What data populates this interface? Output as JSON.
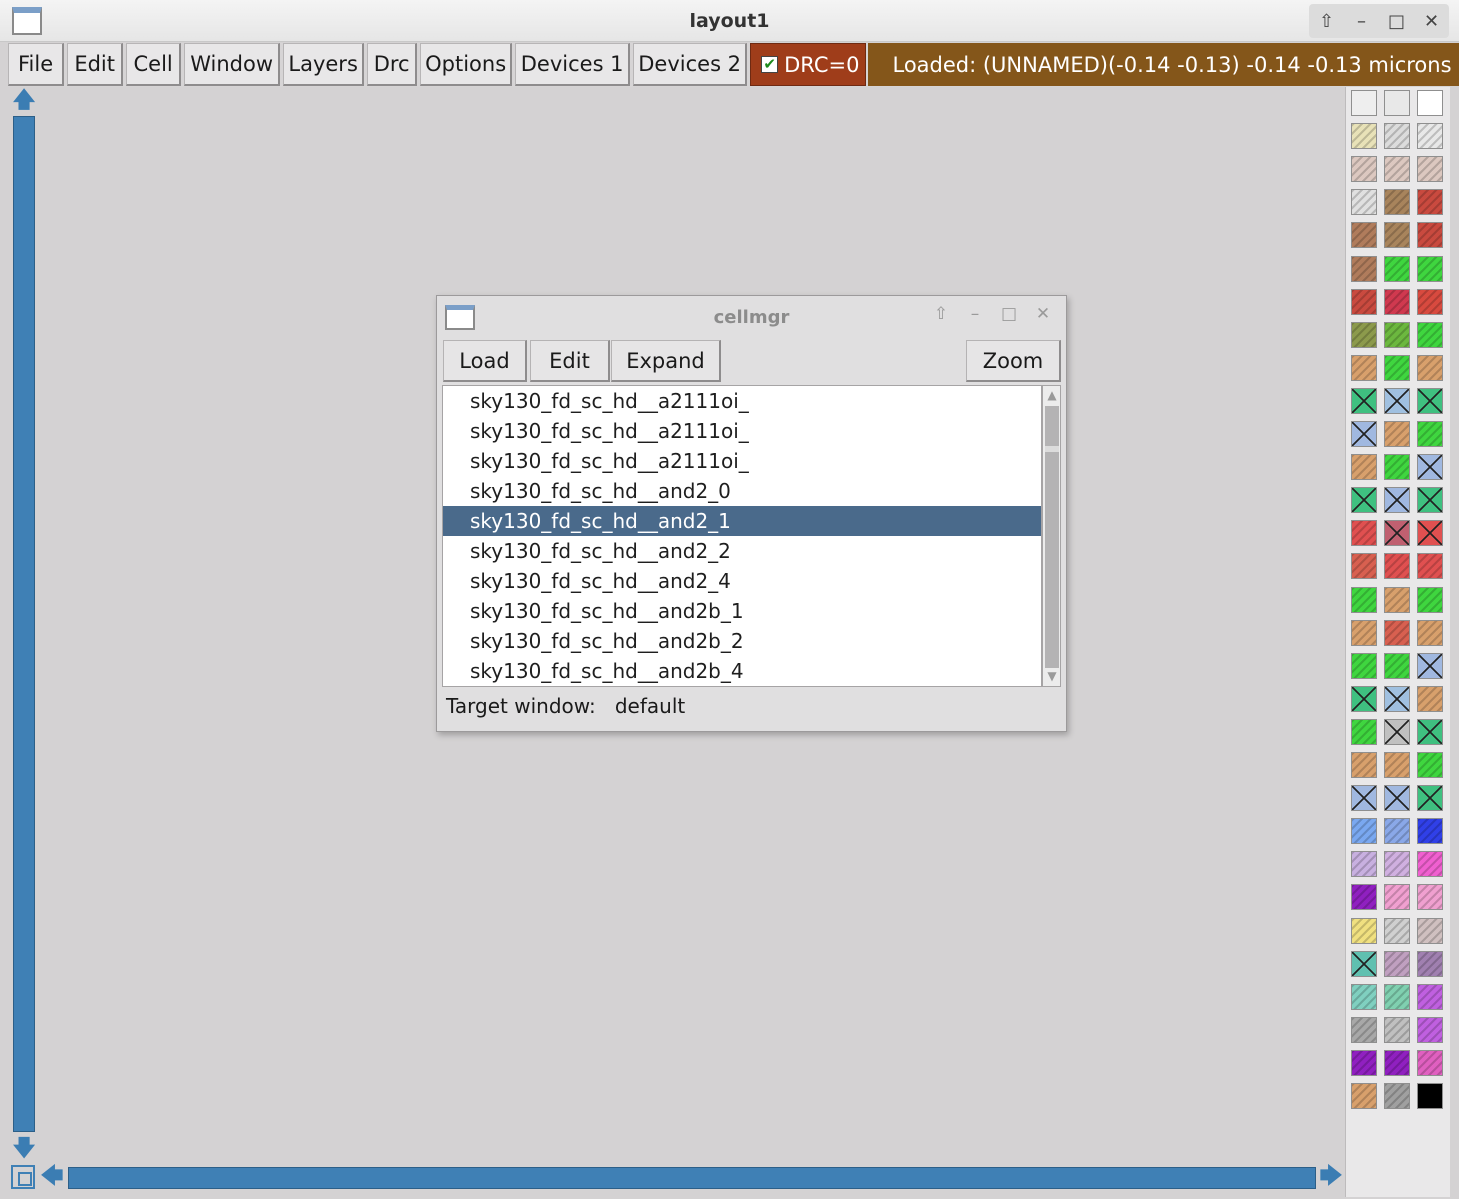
{
  "window": {
    "title": "layout1",
    "controls": [
      "⇧",
      "–",
      "□",
      "✕"
    ]
  },
  "menu": [
    {
      "label": "File",
      "w": 58
    },
    {
      "label": "Edit",
      "w": 56
    },
    {
      "label": "Cell",
      "w": 55
    },
    {
      "label": "Window",
      "w": 96
    },
    {
      "label": "Layers",
      "w": 81
    },
    {
      "label": "Drc",
      "w": 50
    },
    {
      "label": "Options",
      "w": 92
    },
    {
      "label": "Devices 1",
      "w": 115
    },
    {
      "label": "Devices 2",
      "w": 114
    }
  ],
  "drc": {
    "label": "DRC=0",
    "checked": true
  },
  "status": {
    "loaded": "Loaded: (UNNAMED)",
    "coords": "(-0.14 -0.13) -0.14 -0.13 microns"
  },
  "colors": {
    "accent_blue": "#3f80b5",
    "drc_bg": "#9f3d1a",
    "status_bg": "#84561a",
    "selection": "#4a6a8b"
  },
  "cellmgr": {
    "title": "cellmgr",
    "buttons": {
      "load": "Load",
      "edit": "Edit",
      "expand": "Expand",
      "zoom": "Zoom"
    },
    "items": [
      "sky130_fd_sc_hd__a2111oi_",
      "sky130_fd_sc_hd__a2111oi_",
      "sky130_fd_sc_hd__a2111oi_",
      "sky130_fd_sc_hd__and2_0",
      "sky130_fd_sc_hd__and2_1",
      "sky130_fd_sc_hd__and2_2",
      "sky130_fd_sc_hd__and2_4",
      "sky130_fd_sc_hd__and2b_1",
      "sky130_fd_sc_hd__and2b_2",
      "sky130_fd_sc_hd__and2b_4"
    ],
    "selected_index": 4,
    "target_label": "Target window:",
    "target_value": "default"
  },
  "palette": [
    [
      "#eeeeee",
      "#e8e8e8",
      "#ffffff"
    ],
    [
      "#e8e2b8",
      "#dcdcdc",
      "#e8e8e8"
    ],
    [
      "#dcc8c0",
      "#dcc8c0",
      "#dcc8c0"
    ],
    [
      "#e0e0e0",
      "#a8845c",
      "#c94a3f"
    ],
    [
      "#b07c5c",
      "#a8845c",
      "#c94a3f"
    ],
    [
      "#b07c5c",
      "#3fd63f",
      "#3fd63f"
    ],
    [
      "#c94a3f",
      "#d0394f",
      "#d84a3f"
    ],
    [
      "#8c9a4c",
      "#6cb83f",
      "#3fd63f"
    ],
    [
      "#d8a06c",
      "#3fd63f",
      "#d8a06c"
    ],
    [
      "#3fc080",
      "#a0c0e0",
      "#3fc080"
    ],
    [
      "#a0b8e0",
      "#d8a06c",
      "#3fd63f"
    ],
    [
      "#d8a06c",
      "#3fd63f",
      "#a0b8e0"
    ],
    [
      "#3fc080",
      "#a0b8e0",
      "#3fc080"
    ],
    [
      "#e05050",
      "#c06070",
      "#e05050"
    ],
    [
      "#d86050",
      "#e05050",
      "#e05050"
    ],
    [
      "#3fd63f",
      "#d8a06c",
      "#3fd63f"
    ],
    [
      "#d8a06c",
      "#d86050",
      "#d8a06c"
    ],
    [
      "#3fd63f",
      "#3fd63f",
      "#a0b8e0"
    ],
    [
      "#3fc080",
      "#a0c0e0",
      "#d8a06c"
    ],
    [
      "#3fd63f",
      "#c0c0c0",
      "#3fc080"
    ],
    [
      "#d8a06c",
      "#d8a06c",
      "#3fd63f"
    ],
    [
      "#a0b8e0",
      "#a0b8e0",
      "#3fc080"
    ],
    [
      "#7aa8f0",
      "#8aa8e8",
      "#3040e8"
    ],
    [
      "#c8b0e0",
      "#d0b0e0",
      "#f060d0"
    ],
    [
      "#9020c0",
      "#f0a0d0",
      "#f0a0d0"
    ],
    [
      "#f0e080",
      "#d0d0d0",
      "#d0c0c0"
    ],
    [
      "#60c0b0",
      "#c0a0c0",
      "#a080b0"
    ],
    [
      "#80d0c0",
      "#80d0b0",
      "#c060e0"
    ],
    [
      "#a8a8a8",
      "#c0c0c0",
      "#c060e0"
    ],
    [
      "#9020c0",
      "#9020c0",
      "#e060c0"
    ],
    [
      "#d8a06c",
      "#a0a0a0",
      "#000000"
    ]
  ],
  "cross_swatches": [
    [
      9,
      0
    ],
    [
      9,
      1
    ],
    [
      9,
      2
    ],
    [
      10,
      0
    ],
    [
      11,
      2
    ],
    [
      12,
      0
    ],
    [
      12,
      1
    ],
    [
      12,
      2
    ],
    [
      13,
      1
    ],
    [
      13,
      2
    ],
    [
      17,
      2
    ],
    [
      18,
      0
    ],
    [
      18,
      1
    ],
    [
      19,
      1
    ],
    [
      19,
      2
    ],
    [
      21,
      0
    ],
    [
      21,
      1
    ],
    [
      21,
      2
    ],
    [
      26,
      0
    ]
  ]
}
